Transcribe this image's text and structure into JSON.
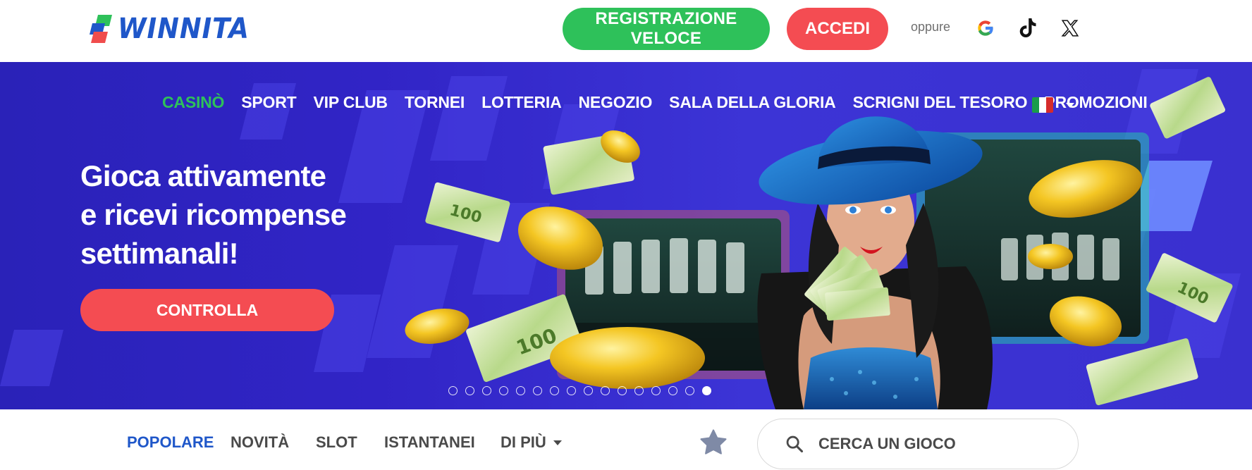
{
  "header": {
    "logo_text": "WINNITA",
    "register_label": "REGISTRAZIONE VELOCE",
    "login_label": "ACCEDI",
    "or_label": "oppure",
    "social": [
      "google-icon",
      "tiktok-icon",
      "x-icon"
    ]
  },
  "nav": {
    "items": [
      {
        "label": "CASINÒ",
        "active": true
      },
      {
        "label": "SPORT"
      },
      {
        "label": "VIP CLUB"
      },
      {
        "label": "TORNEI"
      },
      {
        "label": "LOTTERIA"
      },
      {
        "label": "NEGOZIO"
      },
      {
        "label": "SALA DELLA GLORIA"
      },
      {
        "label": "SCRIGNI DEL TESORO"
      },
      {
        "label": "PROMOZIONI"
      }
    ],
    "language": "italian-flag-icon"
  },
  "banner": {
    "headline": [
      "Gioca attivamente",
      "e ricevi ricompense",
      "settimanali!"
    ],
    "cta_label": "CONTROLLA",
    "slides_total": 16,
    "slide_active": 16
  },
  "tabs": {
    "items": [
      {
        "label": "POPOLARE",
        "active": true
      },
      {
        "label": "NOVITÀ"
      },
      {
        "label": "SLOT"
      },
      {
        "label": "ISTANTANEI"
      },
      {
        "label": "DI PIÙ"
      }
    ],
    "search_placeholder": "CERCA UN GIOCO"
  },
  "colors": {
    "green": "#2ec15a",
    "red": "#f44c52",
    "blue": "#1f57c9",
    "banner": "#3124c6"
  }
}
